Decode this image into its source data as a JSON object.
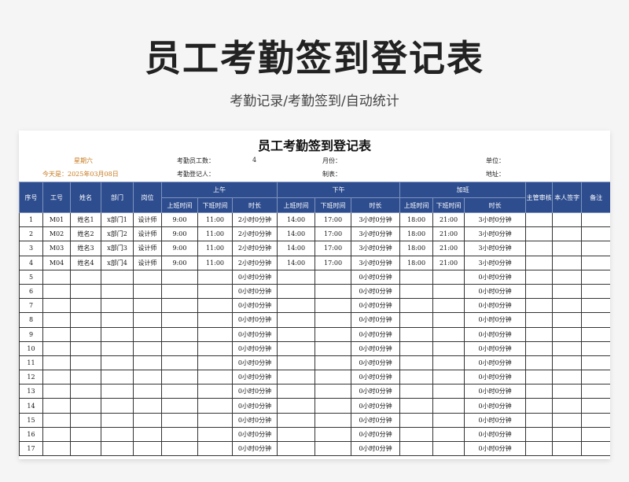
{
  "header": {
    "title": "员工考勤签到登记表",
    "subtitle": "考勤记录/考勤签到/自动统计"
  },
  "sheet": {
    "title": "员工考勤签到登记表",
    "weekday": "星期六",
    "today": "今天是：2025年03月08日",
    "staff_count_label": "考勤员工数：",
    "staff_count_value": "4",
    "registrar_label": "考勤登记人：",
    "month_label": "月份：",
    "maker_label": "制表：",
    "unit_label": "单位：",
    "address_label": "地址："
  },
  "table": {
    "headers": {
      "seq": "序号",
      "emp_id": "工号",
      "name": "姓名",
      "dept": "部门",
      "post": "岗位",
      "morning": "上午",
      "afternoon": "下午",
      "overtime": "加班",
      "supervisor": "主管审核",
      "signature": "本人签字",
      "remark": "备注",
      "start": "上班时间",
      "end": "下班时间",
      "duration": "时长"
    },
    "rows": [
      {
        "seq": "1",
        "id": "M01",
        "name": "姓名1",
        "dept": "x部门1",
        "post": "设计师",
        "am_in": "9:00",
        "am_out": "11:00",
        "am_dur": "2小时0分钟",
        "pm_in": "14:00",
        "pm_out": "17:00",
        "pm_dur": "3小时0分钟",
        "ot_in": "18:00",
        "ot_out": "21:00",
        "ot_dur": "3小时0分钟"
      },
      {
        "seq": "2",
        "id": "M02",
        "name": "姓名2",
        "dept": "x部门2",
        "post": "设计师",
        "am_in": "9:00",
        "am_out": "11:00",
        "am_dur": "2小时0分钟",
        "pm_in": "14:00",
        "pm_out": "17:00",
        "pm_dur": "3小时0分钟",
        "ot_in": "18:00",
        "ot_out": "21:00",
        "ot_dur": "3小时0分钟"
      },
      {
        "seq": "3",
        "id": "M03",
        "name": "姓名3",
        "dept": "x部门3",
        "post": "设计师",
        "am_in": "9:00",
        "am_out": "11:00",
        "am_dur": "2小时0分钟",
        "pm_in": "14:00",
        "pm_out": "17:00",
        "pm_dur": "3小时0分钟",
        "ot_in": "18:00",
        "ot_out": "21:00",
        "ot_dur": "3小时0分钟"
      },
      {
        "seq": "4",
        "id": "M04",
        "name": "姓名4",
        "dept": "x部门4",
        "post": "设计师",
        "am_in": "9:00",
        "am_out": "11:00",
        "am_dur": "2小时0分钟",
        "pm_in": "14:00",
        "pm_out": "17:00",
        "pm_dur": "3小时0分钟",
        "ot_in": "18:00",
        "ot_out": "21:00",
        "ot_dur": "3小时0分钟"
      },
      {
        "seq": "5",
        "id": "",
        "name": "",
        "dept": "",
        "post": "",
        "am_in": "",
        "am_out": "",
        "am_dur": "0小时0分钟",
        "pm_in": "",
        "pm_out": "",
        "pm_dur": "0小时0分钟",
        "ot_in": "",
        "ot_out": "",
        "ot_dur": "0小时0分钟"
      },
      {
        "seq": "6",
        "id": "",
        "name": "",
        "dept": "",
        "post": "",
        "am_in": "",
        "am_out": "",
        "am_dur": "0小时0分钟",
        "pm_in": "",
        "pm_out": "",
        "pm_dur": "0小时0分钟",
        "ot_in": "",
        "ot_out": "",
        "ot_dur": "0小时0分钟"
      },
      {
        "seq": "7",
        "id": "",
        "name": "",
        "dept": "",
        "post": "",
        "am_in": "",
        "am_out": "",
        "am_dur": "0小时0分钟",
        "pm_in": "",
        "pm_out": "",
        "pm_dur": "0小时0分钟",
        "ot_in": "",
        "ot_out": "",
        "ot_dur": "0小时0分钟"
      },
      {
        "seq": "8",
        "id": "",
        "name": "",
        "dept": "",
        "post": "",
        "am_in": "",
        "am_out": "",
        "am_dur": "0小时0分钟",
        "pm_in": "",
        "pm_out": "",
        "pm_dur": "0小时0分钟",
        "ot_in": "",
        "ot_out": "",
        "ot_dur": "0小时0分钟"
      },
      {
        "seq": "9",
        "id": "",
        "name": "",
        "dept": "",
        "post": "",
        "am_in": "",
        "am_out": "",
        "am_dur": "0小时0分钟",
        "pm_in": "",
        "pm_out": "",
        "pm_dur": "0小时0分钟",
        "ot_in": "",
        "ot_out": "",
        "ot_dur": "0小时0分钟"
      },
      {
        "seq": "10",
        "id": "",
        "name": "",
        "dept": "",
        "post": "",
        "am_in": "",
        "am_out": "",
        "am_dur": "0小时0分钟",
        "pm_in": "",
        "pm_out": "",
        "pm_dur": "0小时0分钟",
        "ot_in": "",
        "ot_out": "",
        "ot_dur": "0小时0分钟"
      },
      {
        "seq": "11",
        "id": "",
        "name": "",
        "dept": "",
        "post": "",
        "am_in": "",
        "am_out": "",
        "am_dur": "0小时0分钟",
        "pm_in": "",
        "pm_out": "",
        "pm_dur": "0小时0分钟",
        "ot_in": "",
        "ot_out": "",
        "ot_dur": "0小时0分钟"
      },
      {
        "seq": "12",
        "id": "",
        "name": "",
        "dept": "",
        "post": "",
        "am_in": "",
        "am_out": "",
        "am_dur": "0小时0分钟",
        "pm_in": "",
        "pm_out": "",
        "pm_dur": "0小时0分钟",
        "ot_in": "",
        "ot_out": "",
        "ot_dur": "0小时0分钟"
      },
      {
        "seq": "13",
        "id": "",
        "name": "",
        "dept": "",
        "post": "",
        "am_in": "",
        "am_out": "",
        "am_dur": "0小时0分钟",
        "pm_in": "",
        "pm_out": "",
        "pm_dur": "0小时0分钟",
        "ot_in": "",
        "ot_out": "",
        "ot_dur": "0小时0分钟"
      },
      {
        "seq": "14",
        "id": "",
        "name": "",
        "dept": "",
        "post": "",
        "am_in": "",
        "am_out": "",
        "am_dur": "0小时0分钟",
        "pm_in": "",
        "pm_out": "",
        "pm_dur": "0小时0分钟",
        "ot_in": "",
        "ot_out": "",
        "ot_dur": "0小时0分钟"
      },
      {
        "seq": "15",
        "id": "",
        "name": "",
        "dept": "",
        "post": "",
        "am_in": "",
        "am_out": "",
        "am_dur": "0小时0分钟",
        "pm_in": "",
        "pm_out": "",
        "pm_dur": "0小时0分钟",
        "ot_in": "",
        "ot_out": "",
        "ot_dur": "0小时0分钟"
      },
      {
        "seq": "16",
        "id": "",
        "name": "",
        "dept": "",
        "post": "",
        "am_in": "",
        "am_out": "",
        "am_dur": "0小时0分钟",
        "pm_in": "",
        "pm_out": "",
        "pm_dur": "0小时0分钟",
        "ot_in": "",
        "ot_out": "",
        "ot_dur": "0小时0分钟"
      },
      {
        "seq": "17",
        "id": "",
        "name": "",
        "dept": "",
        "post": "",
        "am_in": "",
        "am_out": "",
        "am_dur": "0小时0分钟",
        "pm_in": "",
        "pm_out": "",
        "pm_dur": "0小时0分钟",
        "ot_in": "",
        "ot_out": "",
        "ot_dur": "0小时0分钟"
      }
    ]
  },
  "colors": {
    "header_bg": "#2e4d8f",
    "accent_orange": "#c77a1e"
  }
}
